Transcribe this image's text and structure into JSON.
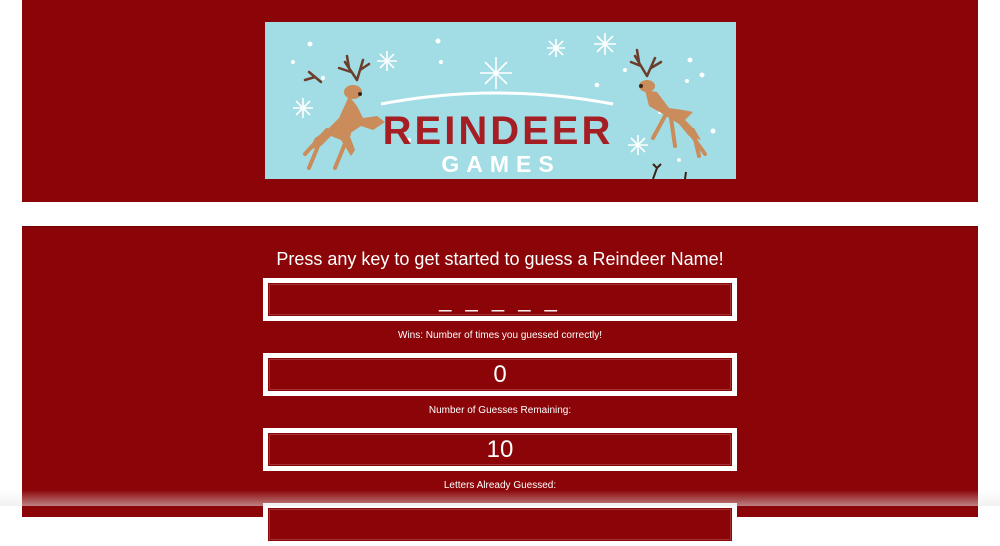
{
  "banner": {
    "title": "REINDEER",
    "subtitle": "GAMES",
    "colors": {
      "sky": "#a2dce4",
      "title": "#a51e24",
      "deer": "#c98c5a"
    }
  },
  "game": {
    "prompt": "Press any key to get started to guess a Reindeer Name!",
    "word_blanks": "_ _ _ _ _",
    "wins_label": "Wins: Number of times you guessed correctly!",
    "wins_value": "0",
    "guesses_label": "Number of Guesses Remaining:",
    "guesses_value": "10",
    "letters_label": "Letters Already Guessed:",
    "letters_value": ""
  },
  "colors": {
    "panel": "#8b0508",
    "border": "#ffffff",
    "text": "#ffffff"
  }
}
